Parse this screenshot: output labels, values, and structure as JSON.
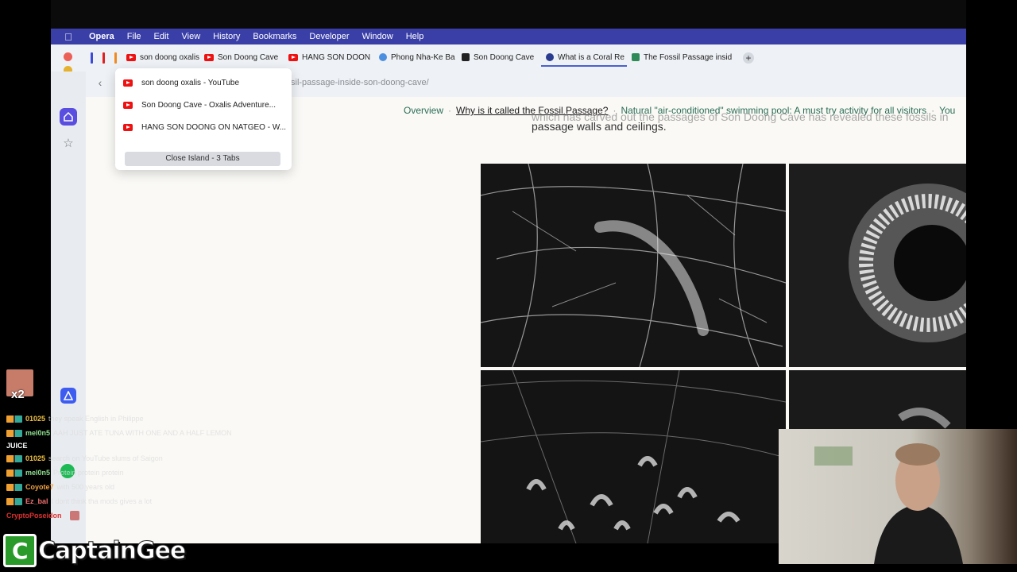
{
  "menubar": {
    "app": "Opera",
    "items": [
      "File",
      "Edit",
      "View",
      "History",
      "Bookmarks",
      "Developer",
      "Window",
      "Help"
    ]
  },
  "tabs": [
    {
      "label": "son doong oxalis",
      "icon": "youtube-icon"
    },
    {
      "label": "Son Doong Cave",
      "icon": "youtube-icon"
    },
    {
      "label": "HANG SON DOON",
      "icon": "youtube-icon"
    },
    {
      "label": "Phong Nha-Ke Ba",
      "icon": "globe-icon"
    },
    {
      "label": "Son Doong Cave",
      "icon": "document-icon"
    },
    {
      "label": "What is a Coral Re",
      "icon": "coral-icon"
    },
    {
      "label": "The Fossil Passage insid",
      "icon": "page-icon"
    }
  ],
  "new_tab": "+",
  "address": {
    "url_fragment": "sil-passage-inside-son-doong-cave/"
  },
  "island_popup": {
    "items": [
      "son doong oxalis - YouTube",
      "Son Doong Cave - Oxalis Adventure...",
      "HANG SON DOONG ON NATGEO - W..."
    ],
    "close_label": "Close Island - 3 Tabs"
  },
  "toc": {
    "items": [
      {
        "label": "Overview",
        "current": false
      },
      {
        "label": "Why is it called the Fossil Passage?",
        "current": true
      },
      {
        "label": "Natural \"air-conditioned\" swimming pool: A must try activity for all visitors",
        "current": false
      },
      {
        "label": "You",
        "current": false
      }
    ]
  },
  "article": {
    "faded_line": "which has carved out the passages of Son Doong Cave has revealed these fossils in",
    "line": "passage walls and ceilings."
  },
  "stream": {
    "multiplier": "x2",
    "chat": [
      {
        "user": "01025",
        "user_color": "#f0c040",
        "message": "they speak English in Philippe"
      },
      {
        "user": "mel0n5",
        "user_color": "#8fe08f",
        "message": "AAH JUST ATE TUNA WITH ONE AND A HALF LEMON"
      },
      {
        "user": "",
        "user_color": "#ffffff",
        "message": "JUICE"
      },
      {
        "user": "01025",
        "user_color": "#f0c040",
        "message": "search on YouTube slums of Saigon"
      },
      {
        "user": "mel0n5",
        "user_color": "#8fe08f",
        "message": "Protein protein protein"
      },
      {
        "user": "Coyote7",
        "user_color": "#f0a040",
        "message": "with 500 years old"
      },
      {
        "user": "Ez_bal",
        "user_color": "#f07070",
        "message": "I dont think tha mods gives a lot"
      },
      {
        "user": "CryptoPoseidon",
        "user_color": "#e03030",
        "message": ""
      }
    ],
    "logo_text": "CaptainGee"
  },
  "colors": {
    "menubar": "#3a3fa8",
    "toc_link": "#2a6d56",
    "accent": "#5a4ee0"
  }
}
